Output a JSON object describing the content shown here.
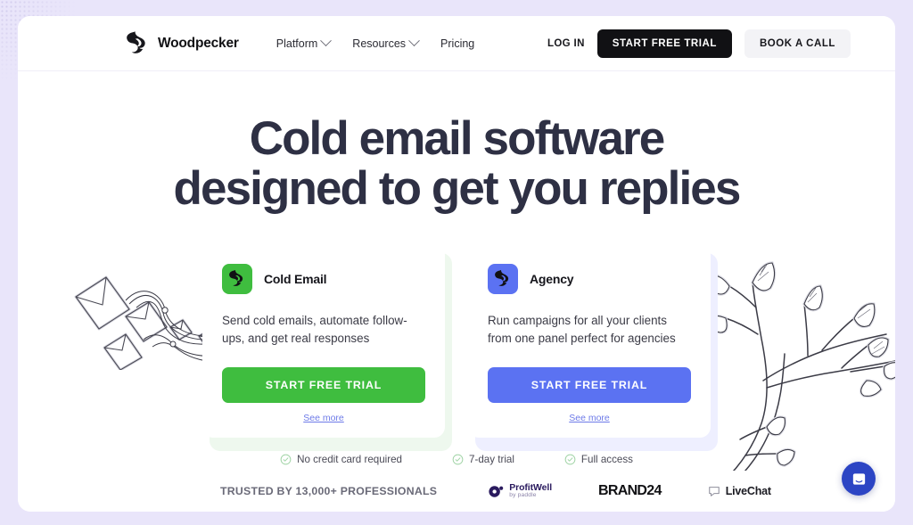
{
  "brand": {
    "name": "Woodpecker",
    "logo_icon": "woodpecker-logo-icon"
  },
  "header": {
    "nav": [
      {
        "label": "Platform",
        "has_chevron": true
      },
      {
        "label": "Resources",
        "has_chevron": true
      },
      {
        "label": "Pricing",
        "has_chevron": false
      }
    ],
    "login_label": "LOG IN",
    "primary_cta": "START FREE TRIAL",
    "secondary_cta": "BOOK A CALL"
  },
  "hero": {
    "headline_line1": "Cold email software",
    "headline_line2": "designed to get you replies",
    "art_left": "flying-envelopes-illustration",
    "art_right": "tree-branch-leaves-illustration"
  },
  "cards": [
    {
      "id": "cold-email",
      "title": "Cold Email",
      "icon": "woodpecker-green-icon",
      "description": "Send cold emails, automate follow-ups, and get real responses",
      "cta_label": "START FREE TRIAL",
      "see_more_label": "See more",
      "accent": "#3fbd3f",
      "shadow_tint": "#eef8ee"
    },
    {
      "id": "agency",
      "title": "Agency",
      "icon": "woodpecker-blue-icon",
      "description": "Run campaigns for all your clients from one panel perfect for agencies",
      "cta_label": "START FREE TRIAL",
      "see_more_label": "See more",
      "accent": "#5b72f2",
      "shadow_tint": "#eeefff"
    }
  ],
  "benefits": [
    {
      "label": "No credit card required",
      "icon": "check-circle-icon"
    },
    {
      "label": "7-day trial",
      "icon": "check-circle-icon"
    },
    {
      "label": "Full access",
      "icon": "check-circle-icon"
    }
  ],
  "trusted": {
    "label": "TRUSTED BY 13,000+ PROFESSIONALS",
    "logos": [
      {
        "id": "profitwell",
        "name": "ProfitWell",
        "sub": "by paddle"
      },
      {
        "id": "brand24",
        "name": "BRAND24"
      },
      {
        "id": "livechat",
        "name": "LiveChat"
      }
    ]
  },
  "chat": {
    "icon": "intercom-chat-icon",
    "color": "#2c45c4"
  },
  "colors": {
    "page_background": "#e9e5fa",
    "headline": "#2e3044",
    "dark_button": "#111114",
    "green_accent": "#3fbd3f",
    "blue_accent": "#5b72f2"
  }
}
